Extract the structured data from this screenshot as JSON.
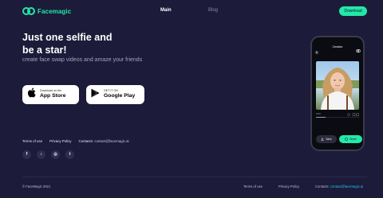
{
  "brand": {
    "name": "Facemagic",
    "accent": "#23e8a8"
  },
  "nav": {
    "items": [
      {
        "label": "Main"
      },
      {
        "label": "Blog"
      }
    ],
    "download_label": "Download"
  },
  "hero": {
    "title_line1": "Just one selfie and",
    "title_line2": "be a star!",
    "subtitle": "create face swap videos and amaze your friends"
  },
  "stores": {
    "apple": {
      "small": "Download on the",
      "big": "App Store",
      "icon": "apple-icon"
    },
    "google": {
      "small": "GET IT ON",
      "big": "Google Play",
      "icon": "google-play-icon"
    }
  },
  "links": {
    "terms": "Terms of use",
    "privacy": "Privacy Policy",
    "contacts_label": "Contacts:",
    "email": "contact@facemagic.ai"
  },
  "socials": [
    {
      "icon": "facebook-icon",
      "glyph": "f"
    },
    {
      "icon": "tiktok-icon",
      "glyph": "♪"
    },
    {
      "icon": "instagram-icon",
      "glyph": "◎"
    },
    {
      "icon": "twitter-icon",
      "glyph": "t"
    }
  ],
  "footer": {
    "copyright": "© FaceMagic 2021",
    "terms": "Terms of use",
    "privacy": "Privacy Policy",
    "contacts_label": "Contacts:",
    "email": "contact@facemagic.ai"
  },
  "phone": {
    "title": "Creation",
    "time": "00:05",
    "save_label": "Save",
    "share_label": "Share"
  }
}
